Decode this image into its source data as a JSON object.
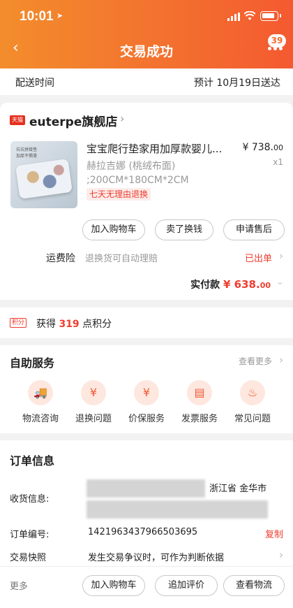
{
  "status_bar": {
    "time": "10:01"
  },
  "header": {
    "title": "交易成功",
    "badge_count": "39"
  },
  "delivery": {
    "label": "配送时间",
    "value": "预计 10月19日送达"
  },
  "shop": {
    "badge": "天猫",
    "name": "euterpe旗舰店",
    "product": {
      "title": "宝宝爬行垫家用加厚款婴儿...",
      "sku": "赫拉吉娜 (桃绒布面) ;200CM*180CM*2CM",
      "price_main": "¥ 738.",
      "price_cents": "00",
      "quantity": "x1",
      "return_policy": "七天无理由退换",
      "image_labels": [
        "坑坑拼接垫",
        "加厚不惧滑"
      ]
    },
    "actions": [
      "加入购物车",
      "卖了换钱",
      "申请售后"
    ],
    "freight": {
      "label": "运费险",
      "desc": "退换货可自动理赔",
      "status": "已出单"
    },
    "paid": {
      "label": "实付款",
      "amount_main": "¥ 638.",
      "amount_cents": "00"
    }
  },
  "points": {
    "tag": "积分",
    "prefix": "获得",
    "value": "319",
    "suffix": "点积分"
  },
  "self_service": {
    "title": "自助服务",
    "more": "查看更多",
    "items": [
      "物流咨询",
      "退换问题",
      "价保服务",
      "发票服务",
      "常见问题"
    ]
  },
  "order_info": {
    "title": "订单信息",
    "receiver_label": "收货信息:",
    "receiver_visible": "浙江省 金华市",
    "order_no_label": "订单编号:",
    "order_no": "1421963437966503695",
    "copy_label": "复制",
    "snapshot_label": "交易快照",
    "snapshot_desc": "发生交易争议时，可作为判断依据"
  },
  "bottom_bar": {
    "more": "更多",
    "buttons": [
      "加入购物车",
      "追加评价",
      "查看物流"
    ]
  }
}
